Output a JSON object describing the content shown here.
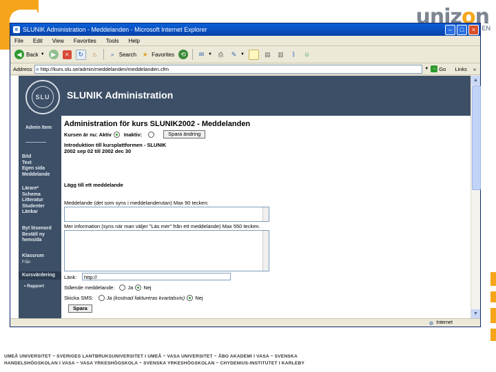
{
  "slide": {
    "logo_text_a": "uniz",
    "logo_text_o": "o",
    "logo_text_b": "n",
    "en_link": "EN",
    "footer_line1": "UMEÅ UNIVERSITET ~ SVERIGES LANTBRUKSUNIVERSITET I UMEÅ ~ VASA UNIVERSITET ~ ÅBO AKADEMI I VASA ~ SVENSKA",
    "footer_line2": "HANDELSHÖGSKOLAN I VASA ~ VASA YRKESHÖGSKOLA ~ SVENSKA YRKESHÖGSKOLAN ~ CHYDENIUS-INSTITUTET I KARLEBY",
    "accent": "#f6a51b"
  },
  "browser": {
    "title": "SLUNIK Administration - Meddelanden - Microsoft Internet Explorer",
    "menu": [
      "File",
      "Edit",
      "View",
      "Favorites",
      "Tools",
      "Help"
    ],
    "toolbar": {
      "back": "Back",
      "search": "Search",
      "favorites": "Favorites"
    },
    "address_label": "Address",
    "address_value": "http://kurs.slu.se/admin/meddelanden/meddelanden.cfm",
    "go_label": "Go",
    "links_label": "Links",
    "status_zone": "Internet"
  },
  "page": {
    "seal_text": "SLU",
    "site_title": "SLUNIK Administration",
    "side_nav": {
      "admin_item": "Admin Item",
      "group1": [
        "Bild",
        "Text",
        "Egen sida",
        "Meddelande"
      ],
      "group2": [
        "Lärare*",
        "Schema",
        "Litteratur",
        "Studenter",
        "Länkar"
      ],
      "group3": [
        "Byt lösenord",
        "Beställ ny",
        "hemsida"
      ],
      "classroom": "Klassrum",
      "classroom_sub": "Från",
      "course_eval": "Kursvärdering",
      "course_eval_item": "• Rapport"
    },
    "main": {
      "title": "Administration för kurs SLUNIK2002 - Meddelanden",
      "course_status_label": "Kursen är nu: Aktiv",
      "inactive_label": "Inaktiv:",
      "save_button": "Spara ändring",
      "intro_line1": "Introduktion till kursplattformen - SLUNIK",
      "intro_line2": "2002 sep 02 till 2002 dec 30",
      "add_heading": "Lägg till ett meddelande",
      "message_label": "Meddelande (det som syns i meddelanderutan) Max 90 tecken:",
      "more_info_label": "Mer information (syns när man väljer \"Läs mer\" från ett meddelande) Max 550 tecken.",
      "link_label": "Länk:",
      "link_value": "http://",
      "stand_label": "Stående meddelande:",
      "yes": "Ja",
      "no": "Nej",
      "sms_label": "Skicka SMS:",
      "sms_yes": "Ja (kostnad faktureras kvartalsvis)",
      "sms_no": "Nej",
      "submit_button": "Spara"
    }
  }
}
